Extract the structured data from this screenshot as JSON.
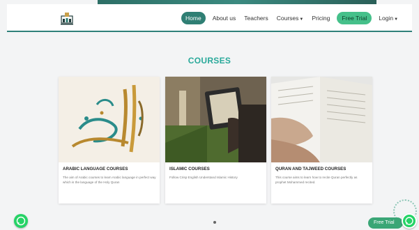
{
  "nav": {
    "home": "Home",
    "about": "About us",
    "teachers": "Teachers",
    "courses": "Courses",
    "pricing": "Pricing",
    "free_trial": "Free Trial",
    "login": "Login"
  },
  "section": {
    "title": "COURSES"
  },
  "cards": [
    {
      "title": "ARABIC LANGUAGE COURSES",
      "desc": "The aim of Arabic courses to learn Arabic language in perfect way which is the language of the Holy Quran"
    },
    {
      "title": "ISLAMIC COURSES",
      "desc": "Follow Crisp English Understand Islamic History"
    },
    {
      "title": "QURAN AND TAJWEED COURSES",
      "desc": "This course aims to learn how to recite Quran perfectly as prophet Mohammed recited."
    }
  ],
  "floating": {
    "free_trial": "Free Trial"
  },
  "colors": {
    "brand": "#2f7f74",
    "accent_green": "#45c08a",
    "section_title": "#29a99a",
    "whatsapp": "#25d366"
  },
  "icons": {
    "logo": "academy-logo-icon",
    "whatsapp": "whatsapp-icon"
  }
}
